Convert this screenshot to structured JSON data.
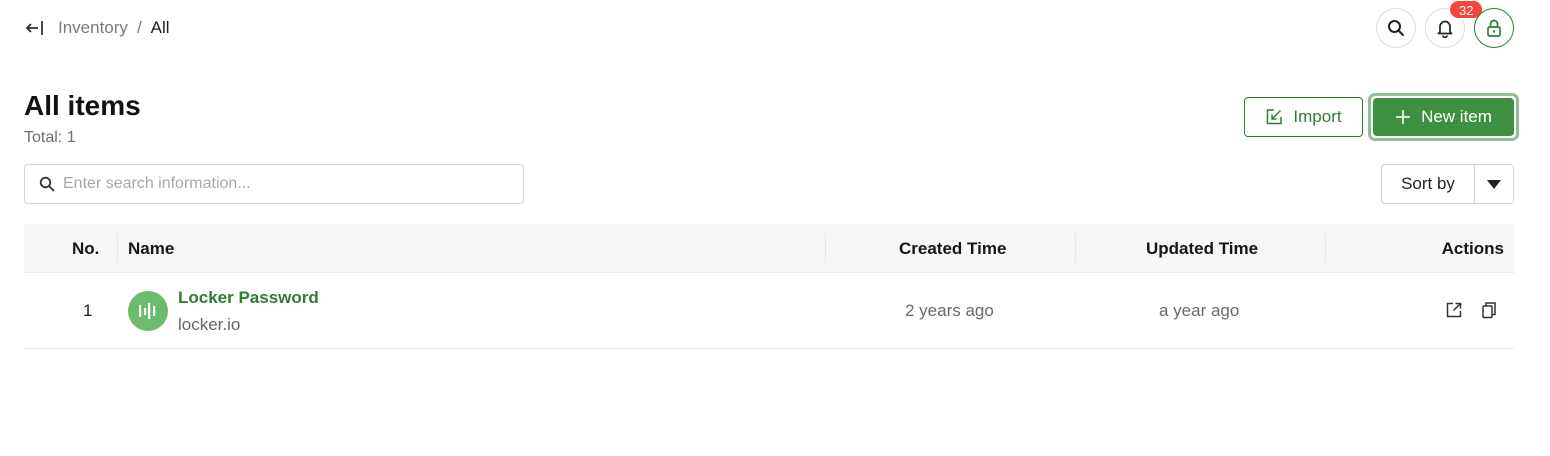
{
  "breadcrumb": {
    "parent": "Inventory",
    "separator": "/",
    "current": "All"
  },
  "header_actions": {
    "notification_count": "32"
  },
  "page": {
    "title": "All items",
    "total": "Total: 1"
  },
  "toolbar": {
    "import_label": "Import",
    "new_item_label": "New item"
  },
  "search": {
    "placeholder": "Enter search information..."
  },
  "sort": {
    "label": "Sort by"
  },
  "table": {
    "columns": [
      "No.",
      "Name",
      "Created Time",
      "Updated Time",
      "Actions"
    ],
    "rows": [
      {
        "no": "1",
        "name": "Locker Password",
        "subtitle": "locker.io",
        "created": "2 years ago",
        "updated": "a year ago"
      }
    ]
  },
  "colors": {
    "primary": "#3d8f41",
    "accent_text": "#2e7d32",
    "badge": "#f5453d",
    "logo_bg": "#6dbb6e"
  },
  "icons": [
    "collapse-sidebar-icon",
    "search-icon",
    "bell-icon",
    "lock-icon",
    "import-icon",
    "plus-icon",
    "caret-down-icon",
    "locker-logo-icon",
    "open-external-icon",
    "copy-icon"
  ]
}
